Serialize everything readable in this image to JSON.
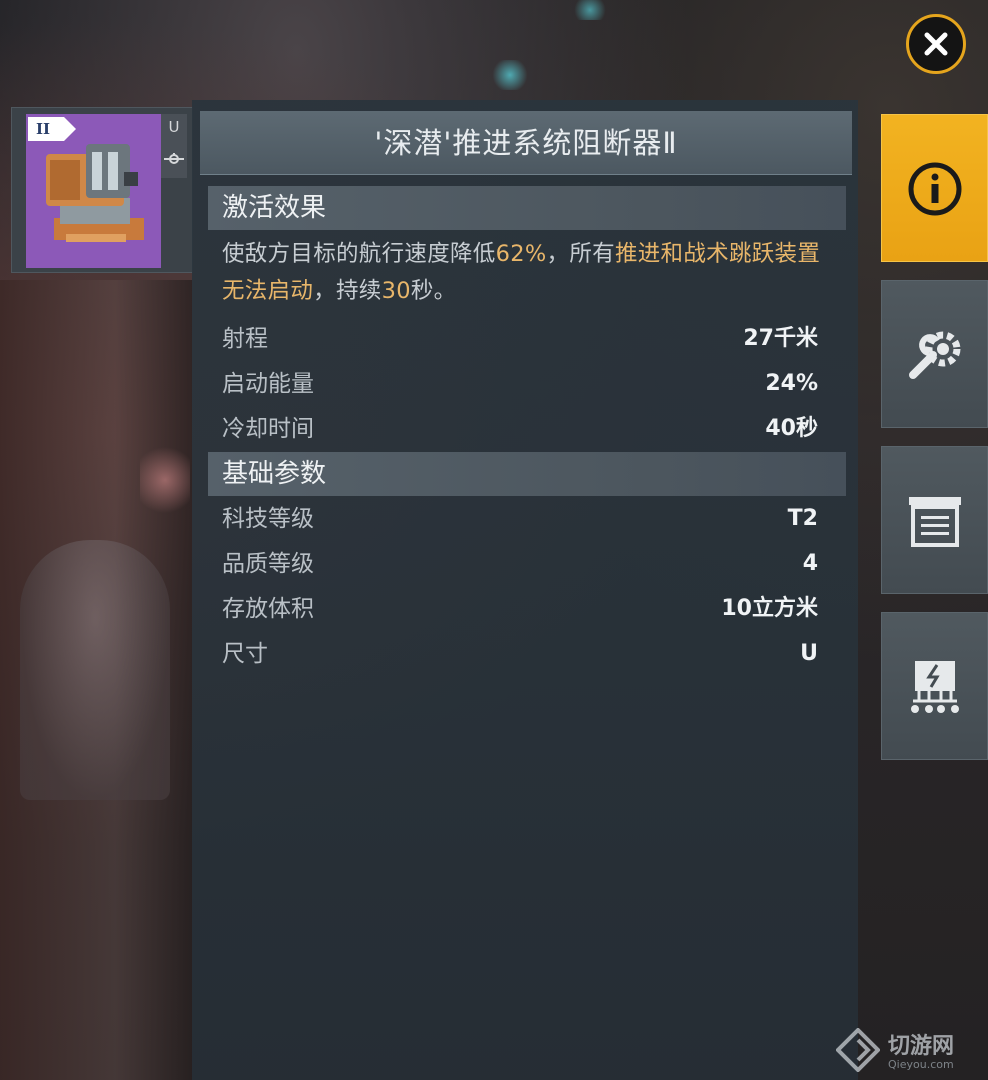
{
  "colors": {
    "accent": "#e5a51d",
    "highlight": "#e8b66a",
    "panel": "#2b3740",
    "item_bg": "#8c59b8"
  },
  "item": {
    "tier_badge": "II",
    "size_letter": "U",
    "icon": "stasis-webifier-module-icon"
  },
  "title": "'深潜'推进系统阻断器Ⅱ",
  "activation": {
    "header": "激活效果",
    "desc_parts": [
      {
        "text": "使敌方目标的航行速度降低",
        "highlight": false
      },
      {
        "text": "62%",
        "highlight": true
      },
      {
        "text": "，所有",
        "highlight": false
      },
      {
        "text": "推进和战术跳跃装置无法启动",
        "highlight": true
      },
      {
        "text": "，持续",
        "highlight": false
      },
      {
        "text": "30",
        "highlight": true
      },
      {
        "text": "秒。",
        "highlight": false
      }
    ],
    "stats": [
      {
        "label": "射程",
        "value": "27千米"
      },
      {
        "label": "启动能量",
        "value": "24%"
      },
      {
        "label": "冷却时间",
        "value": "40秒"
      }
    ]
  },
  "basic": {
    "header": "基础参数",
    "stats": [
      {
        "label": "科技等级",
        "value": "T2"
      },
      {
        "label": "品质等级",
        "value": "4"
      },
      {
        "label": "存放体积",
        "value": "10立方米"
      },
      {
        "label": "尺寸",
        "value": "U"
      }
    ]
  },
  "tabs": [
    {
      "icon": "info-icon",
      "active": true
    },
    {
      "icon": "wrench-gear-icon",
      "active": false
    },
    {
      "icon": "list-box-icon",
      "active": false
    },
    {
      "icon": "circuit-icon",
      "active": false
    }
  ],
  "watermark": {
    "text": "切游网",
    "sub": "Qieyou.com"
  }
}
